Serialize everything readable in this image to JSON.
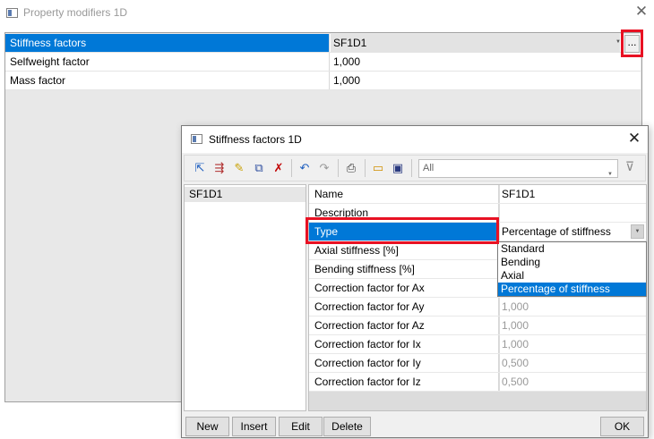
{
  "outer": {
    "title": "Property modifiers 1D",
    "ellipsis_label": "...",
    "rows": [
      {
        "name": "Stiffness factors",
        "value": "SF1D1"
      },
      {
        "name": "Selfweight factor",
        "value": "1,000"
      },
      {
        "name": "Mass factor",
        "value": "1,000"
      }
    ]
  },
  "inner": {
    "title": "Stiffness factors 1D",
    "filter_value": "All",
    "list_items": [
      "SF1D1"
    ],
    "rows": [
      {
        "name": "Name",
        "value": "SF1D1"
      },
      {
        "name": "Description",
        "value": ""
      },
      {
        "name": "Type",
        "value": "Percentage of stiffness"
      },
      {
        "name": "Axial stiffness [%]",
        "value": ""
      },
      {
        "name": "Bending stiffness [%]",
        "value": ""
      },
      {
        "name": "Correction factor for Ax",
        "value": ""
      },
      {
        "name": "Correction factor for Ay",
        "value": "1,000"
      },
      {
        "name": "Correction factor for Az",
        "value": "1,000"
      },
      {
        "name": "Correction factor for Ix",
        "value": "1,000"
      },
      {
        "name": "Correction factor for Iy",
        "value": "0,500"
      },
      {
        "name": "Correction factor for Iz",
        "value": "0,500"
      }
    ],
    "type_options": [
      "Standard",
      "Bending",
      "Axial",
      "Percentage of stiffness"
    ],
    "type_selected": "Percentage of stiffness",
    "buttons": {
      "new": "New",
      "insert": "Insert",
      "edit": "Edit",
      "delete": "Delete",
      "ok": "OK"
    }
  },
  "colors": {
    "selection": "#0078d7",
    "highlight_box": "#e81123"
  },
  "icons": [
    "app-window-icon",
    "close-icon",
    "dropdown-arrow-icon",
    "filter-funnel-icon"
  ]
}
